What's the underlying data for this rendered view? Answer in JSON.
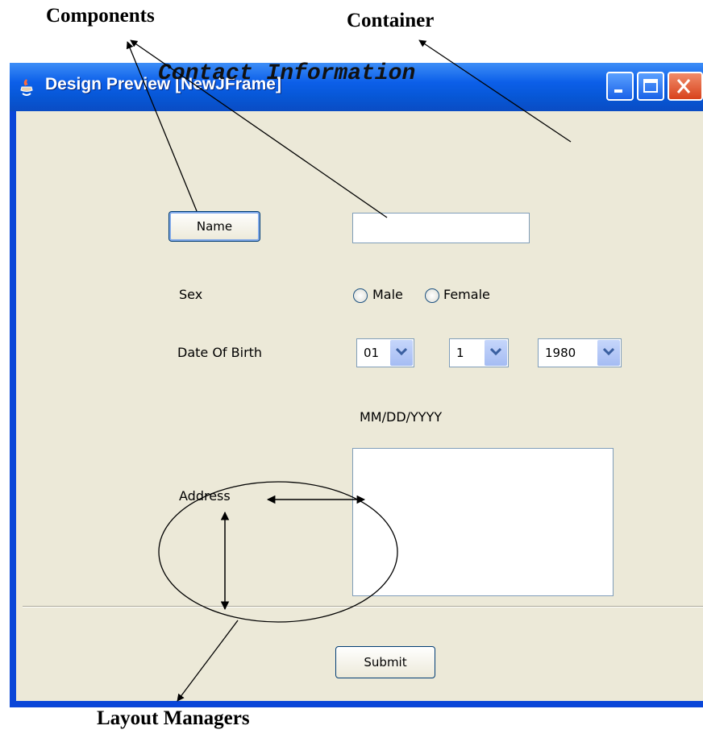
{
  "annotations": {
    "components": "Components",
    "container": "Container",
    "layout_managers": "Layout Managers"
  },
  "window": {
    "title": "Design Preview [NewJFrame]",
    "icon": "java-icon",
    "controls": [
      "minimize-icon",
      "maximize-icon",
      "close-icon"
    ]
  },
  "form": {
    "heading": "Contact Information",
    "name_button": "Name",
    "name_value": "",
    "sex_label": "Sex",
    "sex_options": [
      "Male",
      "Female"
    ],
    "dob_label": "Date Of Birth",
    "dob_month": "01",
    "dob_day": "1",
    "dob_year": "1980",
    "dob_format": "MM/DD/YYYY",
    "address_label": "Address",
    "address_value": "",
    "submit": "Submit"
  },
  "colors": {
    "titlebar": "#0a4cc4",
    "client": "#ece9d8",
    "close_button": "#d8421c"
  }
}
